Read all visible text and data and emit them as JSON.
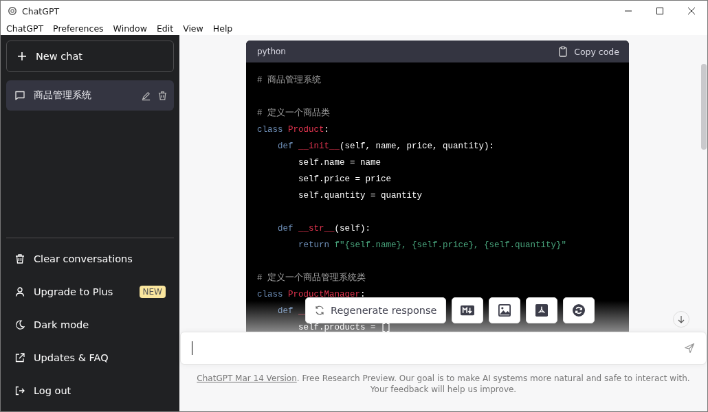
{
  "window": {
    "title": "ChatGPT"
  },
  "menu": [
    "ChatGPT",
    "Preferences",
    "Window",
    "Edit",
    "View",
    "Help"
  ],
  "sidebar": {
    "new_chat": "New chat",
    "conversations": [
      {
        "title": "商品管理系统",
        "selected": true
      }
    ],
    "items": [
      {
        "kind": "trash",
        "label": "Clear conversations"
      },
      {
        "kind": "user",
        "label": "Upgrade to Plus",
        "badge": "NEW"
      },
      {
        "kind": "moon",
        "label": "Dark mode"
      },
      {
        "kind": "external",
        "label": "Updates & FAQ"
      },
      {
        "kind": "logout",
        "label": "Log out"
      }
    ]
  },
  "code_block": {
    "language": "python",
    "copy_label": "Copy code",
    "lines": [
      {
        "tokens": [
          {
            "kind": "comment",
            "text": "# 商品管理系统"
          }
        ]
      },
      {
        "gap_before": true,
        "tokens": [
          {
            "kind": "comment",
            "text": "# 定义一个商品类"
          }
        ]
      },
      {
        "tokens": [
          {
            "kind": "keyword",
            "text": "class"
          },
          {
            "kind": "name",
            "text": " Product"
          },
          {
            "kind": "plain",
            "text": ":"
          }
        ]
      },
      {
        "tokens": [
          {
            "kind": "keyword",
            "text": "    def"
          },
          {
            "kind": "name",
            "text": " __init__"
          },
          {
            "kind": "plain",
            "text": "(self, name, price, quantity):"
          }
        ]
      },
      {
        "tokens": [
          {
            "kind": "plain",
            "text": "        self.name = name"
          }
        ]
      },
      {
        "tokens": [
          {
            "kind": "plain",
            "text": "        self.price = price"
          }
        ]
      },
      {
        "tokens": [
          {
            "kind": "plain",
            "text": "        self.quantity = quantity"
          }
        ]
      },
      {
        "gap_before": true,
        "tokens": [
          {
            "kind": "keyword",
            "text": "    def"
          },
          {
            "kind": "name",
            "text": " __str__"
          },
          {
            "kind": "plain",
            "text": "(self):"
          }
        ]
      },
      {
        "tokens": [
          {
            "kind": "keyword",
            "text": "        return"
          },
          {
            "kind": "string",
            "text": " f\"{self.name}, {self.price}, {self.quantity}\""
          }
        ]
      },
      {
        "gap_before": true,
        "tokens": [
          {
            "kind": "comment",
            "text": "# 定义一个商品管理系统类"
          }
        ]
      },
      {
        "tokens": [
          {
            "kind": "keyword",
            "text": "class"
          },
          {
            "kind": "name",
            "text": " ProductManager"
          },
          {
            "kind": "plain",
            "text": ":"
          }
        ]
      },
      {
        "tokens": [
          {
            "kind": "keyword",
            "text": "    def"
          },
          {
            "kind": "name",
            "text": " __"
          }
        ]
      },
      {
        "tokens": [
          {
            "kind": "plain",
            "text": "        self.products = []"
          }
        ]
      }
    ]
  },
  "actions": {
    "regenerate": "Regenerate response",
    "tools": [
      {
        "kind": "markdown"
      },
      {
        "kind": "image"
      },
      {
        "kind": "pdf"
      },
      {
        "kind": "refresh"
      }
    ]
  },
  "footer": {
    "link": "ChatGPT Mar 14 Version",
    "text": ". Free Research Preview. Our goal is to make AI systems more natural and safe to interact with. Your feedback will help us improve."
  }
}
